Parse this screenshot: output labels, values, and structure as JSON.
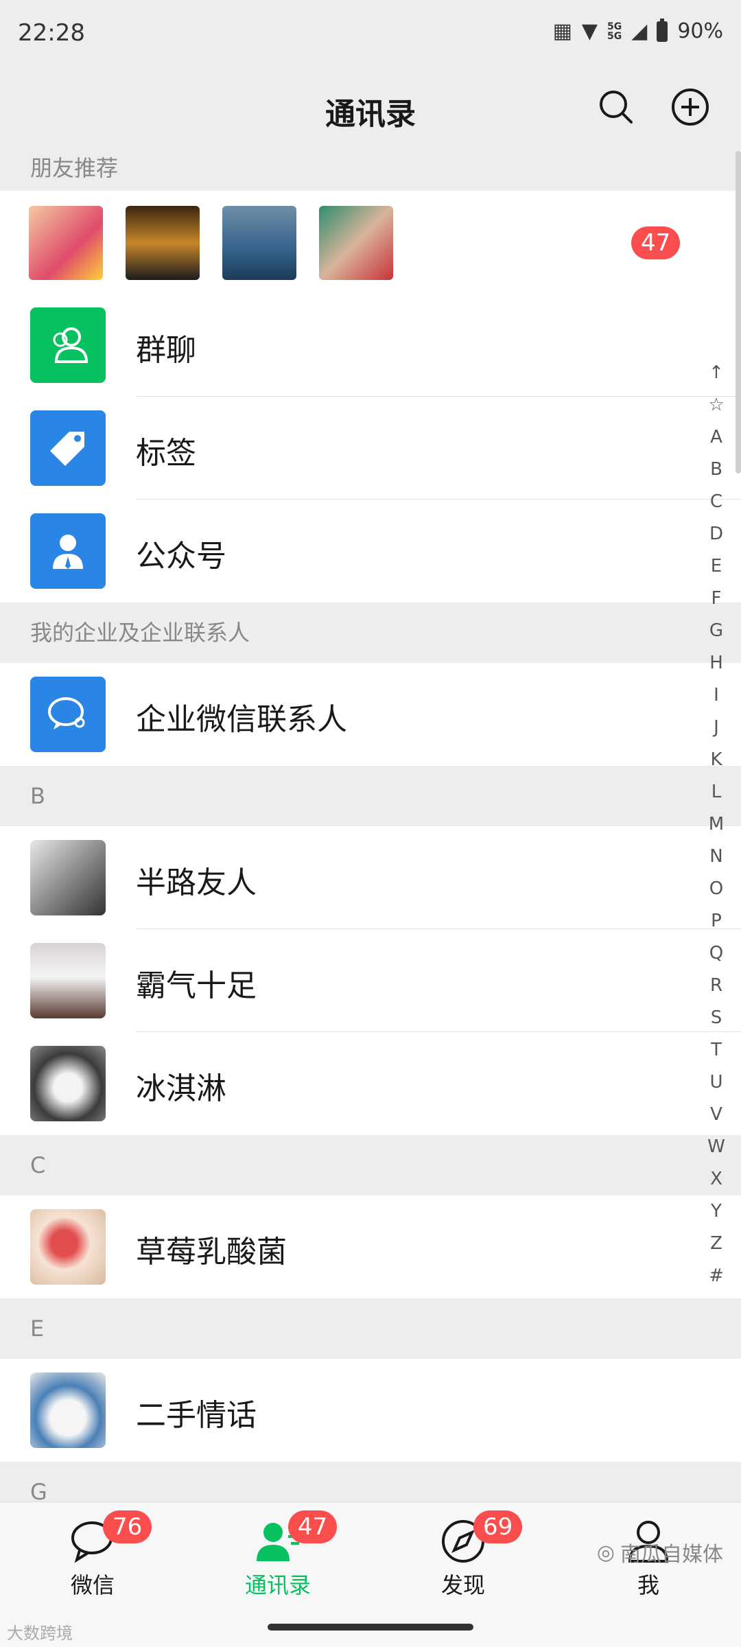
{
  "status_bar": {
    "time": "22:28",
    "network_top": "5G",
    "network_bottom": "5G",
    "battery": "90%"
  },
  "header": {
    "title": "通讯录"
  },
  "sections": {
    "friend_recommend": "朋友推荐",
    "enterprise": "我的企业及企业联系人",
    "letter_b": "B",
    "letter_c": "C",
    "letter_e": "E",
    "letter_g": "G"
  },
  "recommend_badge": "47",
  "menu": [
    {
      "label": "群聊",
      "icon": "group-chat-icon",
      "color": "#07c160"
    },
    {
      "label": "标签",
      "icon": "tag-icon",
      "color": "#2b85e4"
    },
    {
      "label": "公众号",
      "icon": "official-account-icon",
      "color": "#2b85e4"
    }
  ],
  "enterprise_item": {
    "label": "企业微信联系人",
    "icon": "wecom-icon"
  },
  "contacts": {
    "b": [
      "半路友人",
      "霸气十足",
      "冰淇淋"
    ],
    "c": [
      "草莓乳酸菌"
    ],
    "e": [
      "二手情话"
    ]
  },
  "alphabet": [
    "↑",
    "☆",
    "A",
    "B",
    "C",
    "D",
    "E",
    "F",
    "G",
    "H",
    "I",
    "J",
    "K",
    "L",
    "M",
    "N",
    "O",
    "P",
    "Q",
    "R",
    "S",
    "T",
    "U",
    "V",
    "W",
    "X",
    "Y",
    "Z",
    "#"
  ],
  "tabs": [
    {
      "label": "微信",
      "badge": "76",
      "active": false
    },
    {
      "label": "通讯录",
      "badge": "47",
      "active": true
    },
    {
      "label": "发现",
      "badge": "69",
      "active": false
    },
    {
      "label": "我",
      "badge": "",
      "active": false
    }
  ],
  "watermark": {
    "left": "大数跨境",
    "right": "南瓜自媒体"
  },
  "colors": {
    "accent": "#07c160",
    "badge": "#fa4e4e",
    "blue": "#2b85e4"
  }
}
